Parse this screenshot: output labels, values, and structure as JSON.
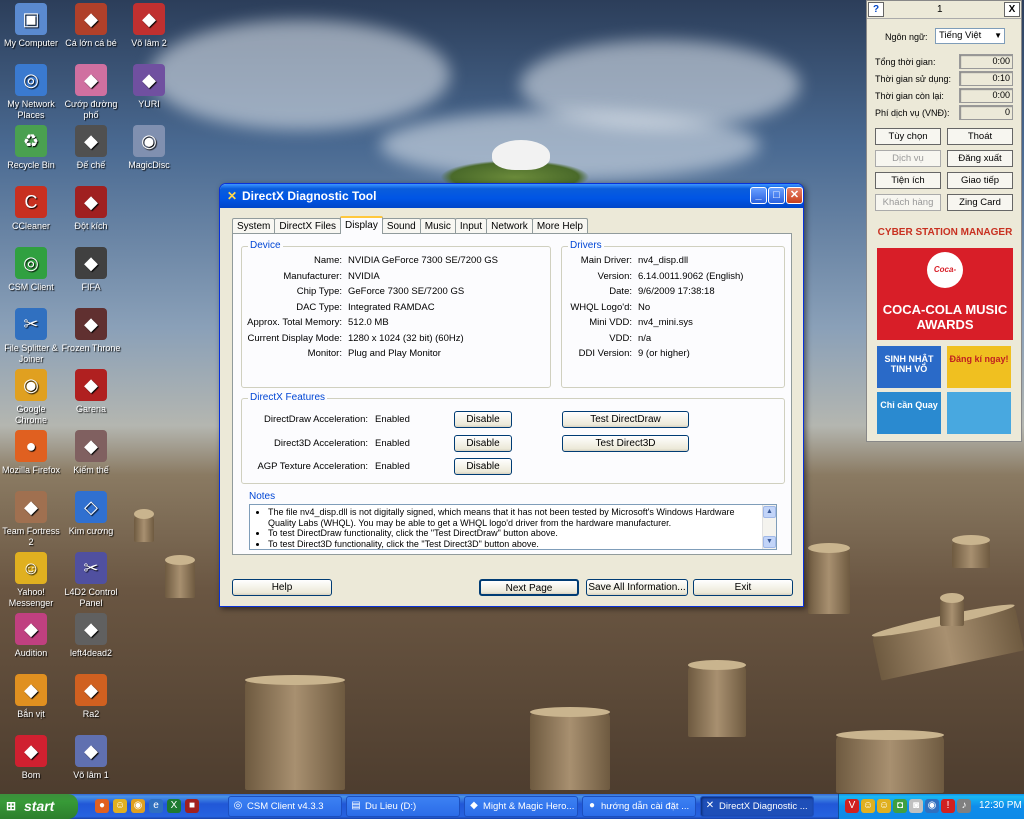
{
  "desktop": {
    "icons": [
      {
        "label": "My Computer",
        "icon": "computer-icon",
        "color": "#5a8ad0"
      },
      {
        "label": "Cá lớn cá bé",
        "icon": "game-icon",
        "color": "#b0402a"
      },
      {
        "label": "Võ lâm 2",
        "icon": "game-icon",
        "color": "#c03030"
      },
      {
        "label": "My Network Places",
        "icon": "network-icon",
        "color": "#3a7ad0"
      },
      {
        "label": "Cướp đường phố",
        "icon": "game-icon",
        "color": "#d070a0"
      },
      {
        "label": "YURI",
        "icon": "game-icon",
        "color": "#7050a0"
      },
      {
        "label": "Recycle Bin",
        "icon": "recycle-bin-icon",
        "color": "#4aa050"
      },
      {
        "label": "Đế chế",
        "icon": "game-icon",
        "color": "#505050"
      },
      {
        "label": "MagicDisc",
        "icon": "disc-icon",
        "color": "#8090b0"
      },
      {
        "label": "CCleaner",
        "icon": "ccleaner-icon",
        "color": "#c83020"
      },
      {
        "label": "Đột kích",
        "icon": "game-icon",
        "color": "#a02020"
      },
      {
        "label": "CSM Client",
        "icon": "network-icon",
        "color": "#30a040"
      },
      {
        "label": "FIFA",
        "icon": "game-icon",
        "color": "#404040"
      },
      {
        "label": "File Splitter & Joiner",
        "icon": "tool-icon",
        "color": "#3070c0"
      },
      {
        "label": "Frozen Throne",
        "icon": "game-icon",
        "color": "#603030"
      },
      {
        "label": "Google Chrome",
        "icon": "chrome-icon",
        "color": "#e0a020"
      },
      {
        "label": "Garena",
        "icon": "game-icon",
        "color": "#b02020"
      },
      {
        "label": "Mozilla Firefox",
        "icon": "firefox-icon",
        "color": "#e06020"
      },
      {
        "label": "Kiếm thế",
        "icon": "game-icon",
        "color": "#806060"
      },
      {
        "label": "Team Fortress 2",
        "icon": "game-icon",
        "color": "#a07050"
      },
      {
        "label": "Kim cương",
        "icon": "diamond-icon",
        "color": "#3070d0"
      },
      {
        "label": "Yahoo! Messenger",
        "icon": "messenger-icon",
        "color": "#e0b020"
      },
      {
        "label": "L4D2 Control Panel",
        "icon": "tool-icon",
        "color": "#5050a0"
      },
      {
        "label": "Audition",
        "icon": "game-icon",
        "color": "#c04080"
      },
      {
        "label": "left4dead2",
        "icon": "game-icon",
        "color": "#606060"
      },
      {
        "label": "Bắn vịt",
        "icon": "game-icon",
        "color": "#e09020"
      },
      {
        "label": "Ra2",
        "icon": "game-icon",
        "color": "#d06020"
      },
      {
        "label": "Bom",
        "icon": "game-icon",
        "color": "#d02030"
      },
      {
        "label": "Võ lâm 1",
        "icon": "game-icon",
        "color": "#6070b0"
      }
    ]
  },
  "dxdiag": {
    "title": "DirectX Diagnostic Tool",
    "tabs": [
      "System",
      "DirectX Files",
      "Display",
      "Sound",
      "Music",
      "Input",
      "Network",
      "More Help"
    ],
    "active_tab": "Display",
    "device": {
      "title": "Device",
      "rows": [
        {
          "label": "Name:",
          "value": "NVIDIA GeForce 7300 SE/7200 GS"
        },
        {
          "label": "Manufacturer:",
          "value": "NVIDIA"
        },
        {
          "label": "Chip Type:",
          "value": "GeForce 7300 SE/7200 GS"
        },
        {
          "label": "DAC Type:",
          "value": "Integrated RAMDAC"
        },
        {
          "label": "Approx. Total Memory:",
          "value": "512.0 MB"
        },
        {
          "label": "Current Display Mode:",
          "value": "1280 x 1024 (32 bit) (60Hz)"
        },
        {
          "label": "Monitor:",
          "value": "Plug and Play Monitor"
        }
      ]
    },
    "drivers": {
      "title": "Drivers",
      "rows": [
        {
          "label": "Main Driver:",
          "value": "nv4_disp.dll"
        },
        {
          "label": "Version:",
          "value": "6.14.0011.9062 (English)"
        },
        {
          "label": "Date:",
          "value": "9/6/2009 17:38:18"
        },
        {
          "label": "WHQL Logo'd:",
          "value": "No"
        },
        {
          "label": "Mini VDD:",
          "value": "nv4_mini.sys"
        },
        {
          "label": "VDD:",
          "value": "n/a"
        },
        {
          "label": "DDI Version:",
          "value": "9 (or higher)"
        }
      ]
    },
    "features": {
      "title": "DirectX Features",
      "rows": [
        {
          "label": "DirectDraw Acceleration:",
          "value": "Enabled",
          "button": "Disable",
          "test": "Test DirectDraw"
        },
        {
          "label": "Direct3D Acceleration:",
          "value": "Enabled",
          "button": "Disable",
          "test": "Test Direct3D"
        },
        {
          "label": "AGP Texture Acceleration:",
          "value": "Enabled",
          "button": "Disable",
          "test": ""
        }
      ]
    },
    "notes": {
      "title": "Notes",
      "items": [
        "The file nv4_disp.dll is not digitally signed, which means that it has not been tested by Microsoft's Windows Hardware Quality Labs (WHQL).  You may be able to get a WHQL logo'd driver from the hardware manufacturer.",
        "To test DirectDraw functionality, click the \"Test DirectDraw\" button above.",
        "To test Direct3D functionality, click the \"Test Direct3D\" button above."
      ]
    },
    "buttons": {
      "help": "Help",
      "next": "Next Page",
      "save": "Save All Information...",
      "exit": "Exit"
    }
  },
  "csm": {
    "top_number": "1",
    "help_label": "?",
    "close_label": "X",
    "language_label": "Ngôn ngữ:",
    "language_value": "Tiếng Việt",
    "stats": [
      {
        "label": "Tổng thời gian:",
        "value": "0:00"
      },
      {
        "label": "Thời gian sử dụng:",
        "value": "0:10"
      },
      {
        "label": "Thời gian còn lại:",
        "value": "0:00"
      },
      {
        "label": "Phí dịch vụ (VNĐ):",
        "value": "0"
      }
    ],
    "buttons": [
      {
        "label": "Tùy chọn",
        "enabled": true
      },
      {
        "label": "Thoát",
        "enabled": true
      },
      {
        "label": "Dịch vụ",
        "enabled": false
      },
      {
        "label": "Đăng xuất",
        "enabled": true
      },
      {
        "label": "Tiện ích",
        "enabled": true
      },
      {
        "label": "Giao tiếp",
        "enabled": true
      },
      {
        "label": "Khách hàng",
        "enabled": false
      },
      {
        "label": "Zing Card",
        "enabled": true
      }
    ],
    "header": "CYBER STATION MANAGER",
    "ad_brand": "Coca-Cola",
    "ad_main": "COCA-COLA MUSIC AWARDS",
    "tiles": [
      "SINH NHẬT TINH VÕ",
      "Đăng kí ngay!",
      "Chỉ cần Quay",
      ""
    ],
    "accent": "#d81e28"
  },
  "taskbar": {
    "start": "start",
    "tasks": [
      {
        "label": "CSM Client v4.3.3",
        "icon": "network-icon"
      },
      {
        "label": "Du Lieu (D:)",
        "icon": "folder-icon"
      },
      {
        "label": "Might & Magic Hero...",
        "icon": "game-icon"
      },
      {
        "label": "hướng dẫn cài đặt ...",
        "icon": "firefox-icon"
      },
      {
        "label": "DirectX Diagnostic ...",
        "icon": "directx-icon"
      }
    ],
    "clock": "12:30 PM"
  }
}
